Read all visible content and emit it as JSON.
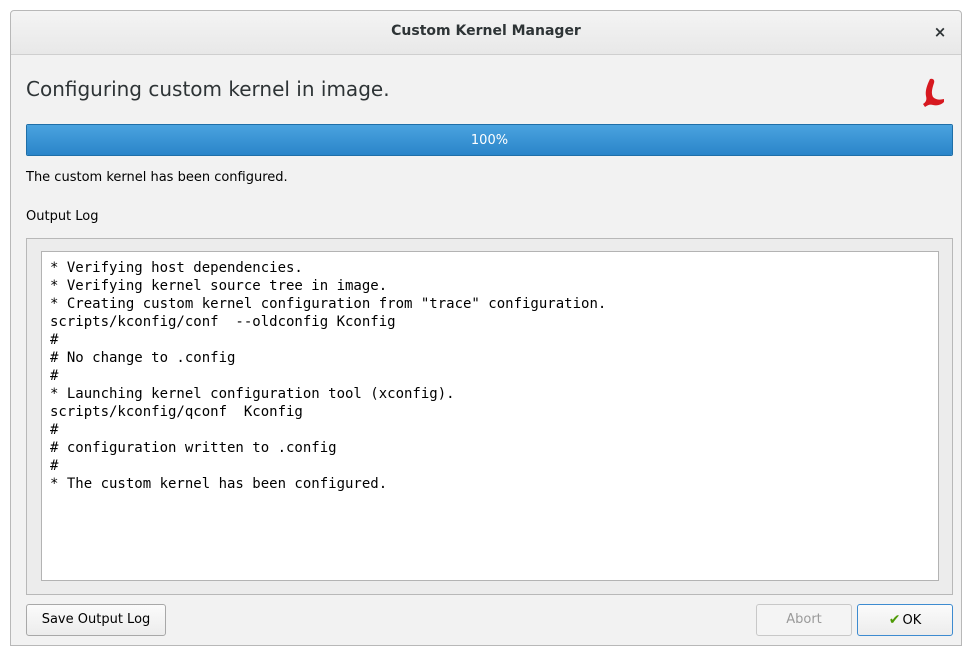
{
  "window": {
    "title": "Custom Kernel Manager",
    "close_glyph": "×"
  },
  "heading": "Configuring custom kernel in image.",
  "logo_icon": "red-bird-logo-icon",
  "progress": {
    "percent": 100,
    "label": "100%"
  },
  "status_text": "The custom kernel has been configured.",
  "log": {
    "label": "Output Log",
    "lines": [
      "* Verifying host dependencies.",
      "* Verifying kernel source tree in image.",
      "* Creating custom kernel configuration from \"trace\" configuration.",
      "scripts/kconfig/conf  --oldconfig Kconfig",
      "#",
      "# No change to .config",
      "#",
      "* Launching kernel configuration tool (xconfig).",
      "scripts/kconfig/qconf  Kconfig",
      "#",
      "# configuration written to .config",
      "#",
      "* The custom kernel has been configured."
    ]
  },
  "buttons": {
    "save_label": "Save Output Log",
    "abort_label": "Abort",
    "ok_label": "OK",
    "ok_icon": "check-icon"
  },
  "colors": {
    "accent": "#2a85c9",
    "logo": "#d71920"
  }
}
